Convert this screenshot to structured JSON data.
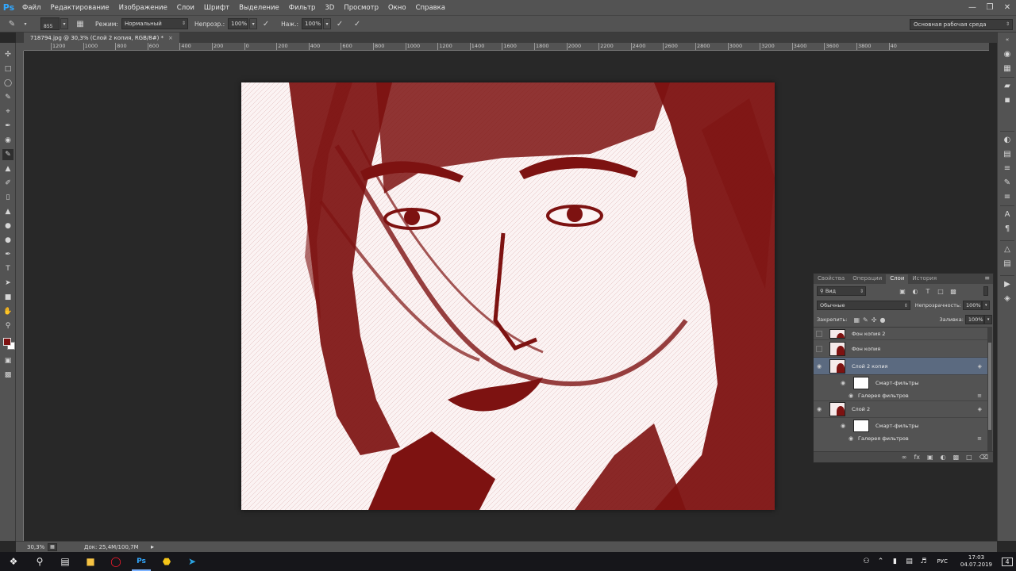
{
  "app": {
    "logo": "Ps"
  },
  "menu": [
    "Файл",
    "Редактирование",
    "Изображение",
    "Слои",
    "Шрифт",
    "Выделение",
    "Фильтр",
    "3D",
    "Просмотр",
    "Окно",
    "Справка"
  ],
  "options": {
    "brush_size": "855",
    "mode_label": "Режим:",
    "mode_value": "Нормальный",
    "opacity_label": "Непрозр.:",
    "opacity_value": "100%",
    "pressure_label": "Наж.:",
    "pressure_value": "100%",
    "workspace": "Основная рабочая среда"
  },
  "document": {
    "tab_title": "718794.jpg @ 30,3% (Слой 2 копия, RGB/8#) *"
  },
  "ruler": {
    "h_labels": [
      "1200",
      "1000",
      "800",
      "600",
      "400",
      "200",
      "0",
      "200",
      "400",
      "600",
      "800",
      "1000",
      "1200",
      "1400",
      "1600",
      "1800",
      "2000",
      "2200",
      "2400",
      "2600",
      "2800",
      "3000",
      "3200",
      "3400",
      "3600",
      "3800",
      "40"
    ]
  },
  "colors": {
    "foreground": "#7d1211",
    "background": "#ffffff",
    "accent": "#31a8ff"
  },
  "layers_panel": {
    "tabs": [
      "Свойства",
      "Операции",
      "Слои",
      "История"
    ],
    "active_tab": "Слои",
    "filter_kind": "Вид",
    "blend_mode": "Обычные",
    "opacity_label": "Непрозрачность:",
    "opacity_value": "100%",
    "lock_label": "Закрепить:",
    "fill_label": "Заливка:",
    "fill_value": "100%",
    "layers": [
      {
        "name": "Фон копия 2",
        "visible": false
      },
      {
        "name": "Фон копия",
        "visible": false
      },
      {
        "name": "Слой 2 копия",
        "visible": true,
        "selected": true,
        "smart_filters": "Смарт-фильтры",
        "filter": "Галерея фильтров"
      },
      {
        "name": "Слой 2",
        "visible": true,
        "smart_filters": "Смарт-фильтры",
        "filter": "Галерея фильтров"
      }
    ]
  },
  "status": {
    "zoom": "30,3%",
    "doc": "Док: 25,4M/100,7M"
  },
  "taskbar": {
    "lang": "РУС",
    "time": "17:03",
    "date": "04.07.2019",
    "notif_count": "4"
  }
}
